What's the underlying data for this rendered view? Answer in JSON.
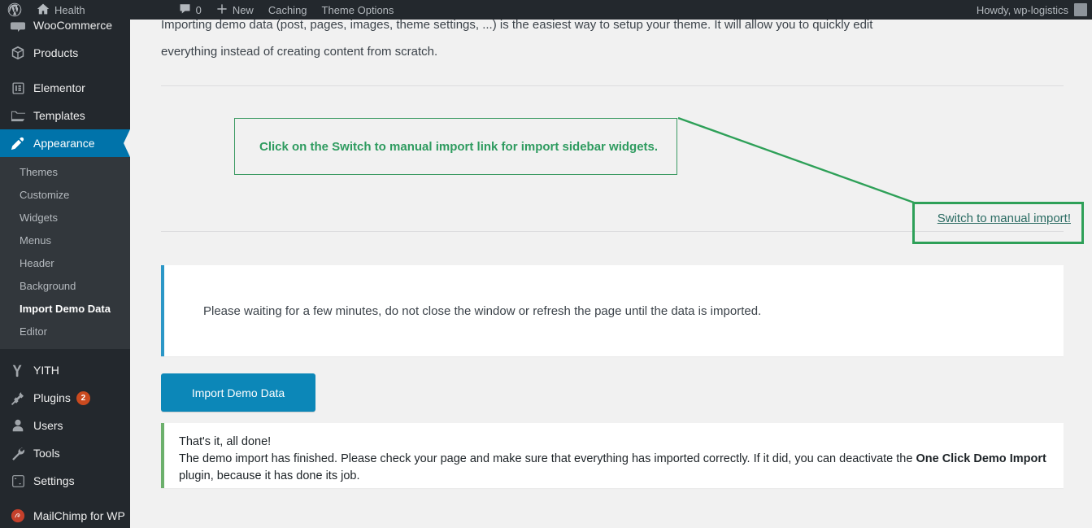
{
  "adminbar": {
    "logo_icon": "wordpress-logo-icon",
    "site_icon": "home-icon",
    "site_name": "Health",
    "comments_icon": "comment-bubble-icon",
    "comments_count": "0",
    "new_icon": "plus-icon",
    "new_label": "New",
    "caching_label": "Caching",
    "theme_options_label": "Theme Options",
    "howdy": "Howdy, wp-logistics",
    "avatar_icon": "user-avatar-icon"
  },
  "sidebar": {
    "items": [
      {
        "label": "WooCommerce",
        "icon": "woocommerce-icon",
        "state": "normal",
        "sep_before": false
      },
      {
        "label": "Products",
        "icon": "products-box-icon",
        "state": "normal",
        "sep_before": false
      },
      {
        "label": "Elementor",
        "icon": "elementor-icon",
        "state": "normal",
        "sep_before": true
      },
      {
        "label": "Templates",
        "icon": "folder-icon",
        "state": "normal",
        "sep_before": false
      },
      {
        "label": "Appearance",
        "icon": "paintbrush-icon",
        "state": "current",
        "sep_before": false
      }
    ],
    "submenu": {
      "parent": "Appearance",
      "items": [
        {
          "label": "Themes",
          "active": false
        },
        {
          "label": "Customize",
          "active": false
        },
        {
          "label": "Widgets",
          "active": false
        },
        {
          "label": "Menus",
          "active": false
        },
        {
          "label": "Header",
          "active": false
        },
        {
          "label": "Background",
          "active": false
        },
        {
          "label": "Import Demo Data",
          "active": true
        },
        {
          "label": "Editor",
          "active": false
        }
      ]
    },
    "items_lower": [
      {
        "label": "YITH",
        "icon": "yith-icon",
        "badge": "",
        "sep_before": true
      },
      {
        "label": "Plugins",
        "icon": "plug-icon",
        "badge": "2",
        "sep_before": false
      },
      {
        "label": "Users",
        "icon": "user-icon",
        "badge": "",
        "sep_before": false
      },
      {
        "label": "Tools",
        "icon": "wrench-icon",
        "badge": "",
        "sep_before": false
      },
      {
        "label": "Settings",
        "icon": "sliders-icon",
        "badge": "",
        "sep_before": false
      },
      {
        "label": "MailChimp for WP",
        "icon": "mailchimp-icon",
        "badge": "",
        "sep_before": true
      }
    ]
  },
  "main": {
    "intro_line1": "Importing demo data (post, pages, images, theme settings, ...) is the easiest way to setup your theme. It will allow you to quickly edit",
    "intro_line2": "everything instead of creating content from scratch.",
    "manual_import_link": "Switch to manual import!",
    "annotation_text": "Click on the Switch to manual import link for import sidebar widgets.",
    "wait_notice": "Please waiting for a few minutes, do not close the window or refresh the page until the data is imported.",
    "import_button": "Import Demo Data",
    "done_title": "That's it, all done!",
    "done_body_1": "The demo import has finished. Please check your page and make sure that everything has imported correctly. If it did, you can deactivate the ",
    "done_body_bold": "One Click Demo Import",
    "done_body_2": " plugin, because it has done its job."
  },
  "colors": {
    "admin_dark": "#23282d",
    "submenu_dark": "#32373c",
    "current_blue": "#0073aa",
    "badge_orange": "#ca4a1f",
    "annotation_green": "#2e9b5f",
    "highlight_green": "#2ea058",
    "link_teal": "#2a6b62",
    "button_blue": "#0c87b8",
    "notice_info_blue": "#2b97c7",
    "notice_success_green": "#6cb06c",
    "page_bg": "#f1f1f1"
  }
}
